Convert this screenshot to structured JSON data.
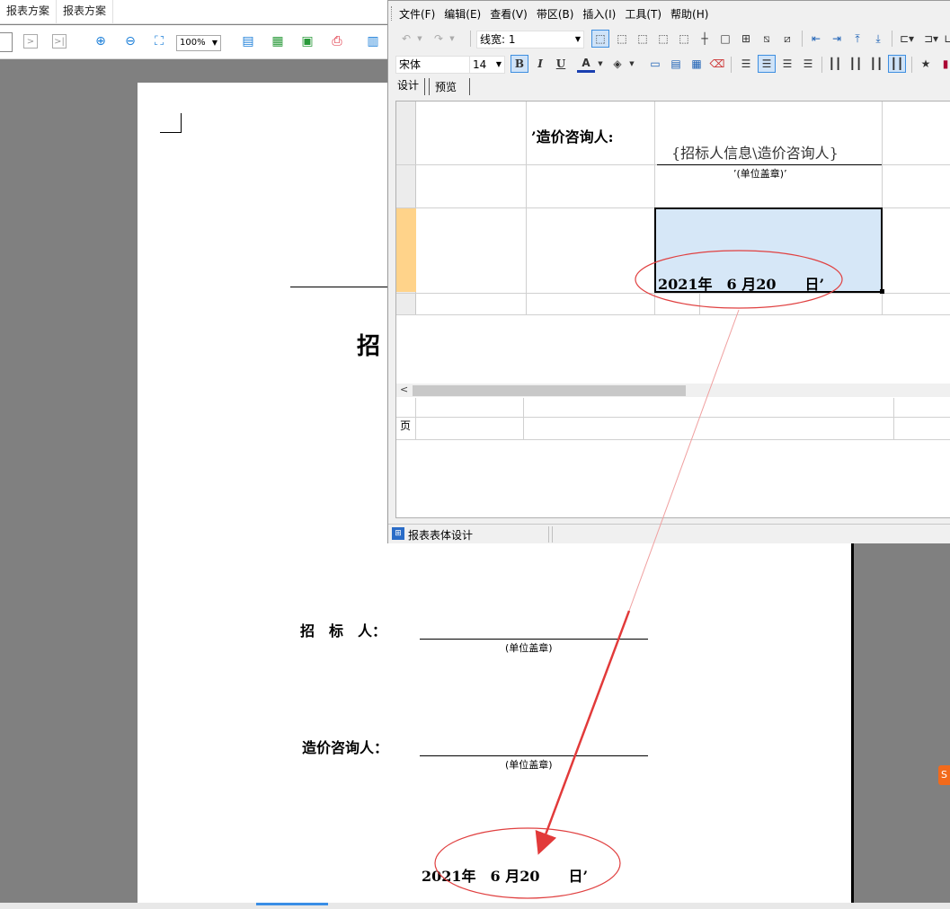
{
  "background_app": {
    "tabs": [
      "报表方案",
      "报表方案"
    ],
    "zoom": "100%"
  },
  "page": {
    "title_char": "招",
    "tenderer_label": "招　标　人：",
    "cost_consultant_label": "造价咨询人：",
    "seal_note": "(单位盖章)",
    "date_text": "2021年　6 月20　　日’"
  },
  "designer": {
    "menu": [
      "文件(F)",
      "编辑(E)",
      "查看(V)",
      "带区(B)",
      "插入(I)",
      "工具(T)",
      "帮助(H)"
    ],
    "line_width_label": "线宽:",
    "line_width_value": "1",
    "font_name": "宋体",
    "font_size": "14",
    "bold": "B",
    "italic": "I",
    "underline": "U",
    "star": "★",
    "tabs": [
      "设计",
      "预览"
    ],
    "cells": {
      "consultant_label": "’造价咨询人:",
      "tenderer_info_field": "{招标人信息\\造价咨询人}",
      "seal_note": "’(单位盖章)’",
      "date_field": "2021年　6 月20　　日’"
    },
    "page_band_label": "页",
    "status_text": "报表表体设计"
  },
  "annotation": {
    "ellipse_color": "#e04040",
    "arrow_color": "#e23a3a"
  }
}
